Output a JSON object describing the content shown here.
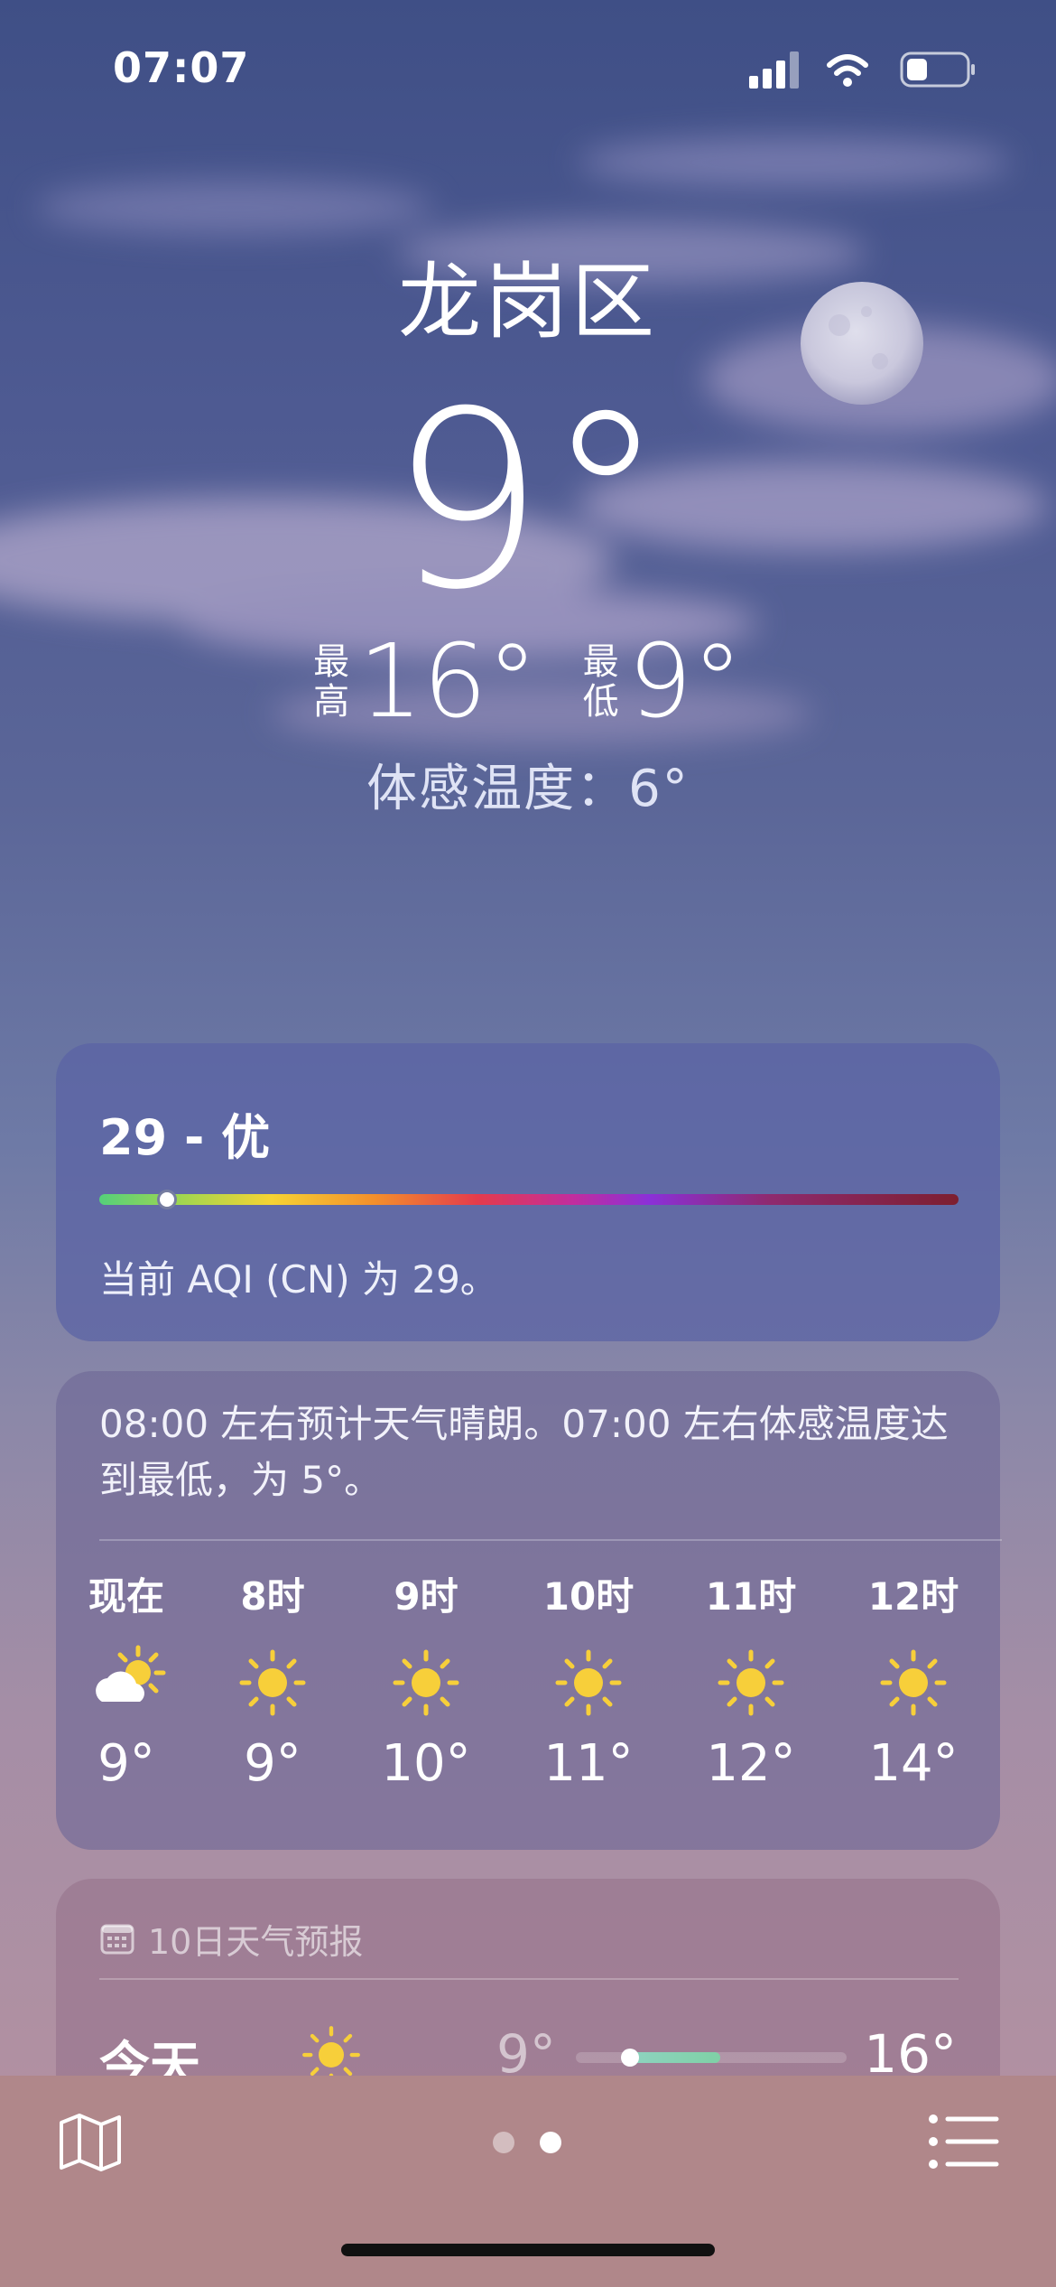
{
  "status_bar": {
    "time": "07:07"
  },
  "location": {
    "city": "龙岗区"
  },
  "current": {
    "temperature": "9°",
    "high_label_1": "最",
    "high_label_2": "高",
    "high_value": "16°",
    "low_label_1": "最",
    "low_label_2": "低",
    "low_value": "9°",
    "feels_like": "体感温度：6°"
  },
  "aqi": {
    "title": "29 - 优",
    "description": "当前 AQI (CN) 为 29。",
    "level": 29
  },
  "hourly": {
    "summary": "08:00 左右预计天气晴朗。07:00 左右体感温度达到最低，为 5°。",
    "items": [
      {
        "label": "现在",
        "icon": "partly-cloudy-icon",
        "temp": "9°"
      },
      {
        "label": "8时",
        "icon": "sun-icon",
        "temp": "9°"
      },
      {
        "label": "9时",
        "icon": "sun-icon",
        "temp": "10°"
      },
      {
        "label": "10时",
        "icon": "sun-icon",
        "temp": "11°"
      },
      {
        "label": "11时",
        "icon": "sun-icon",
        "temp": "12°"
      },
      {
        "label": "12时",
        "icon": "sun-icon",
        "temp": "14°"
      }
    ]
  },
  "forecast": {
    "header": "10日天气预报",
    "days": [
      {
        "day": "今天",
        "icon": "sun-icon",
        "low": "9°",
        "high": "16°"
      }
    ]
  },
  "page_indicator": {
    "count": 2,
    "active": 2
  },
  "colors": {
    "sun": "#f7cf3a",
    "aqi_good": "#55d07a",
    "bottom_bar": "#b0878a"
  }
}
